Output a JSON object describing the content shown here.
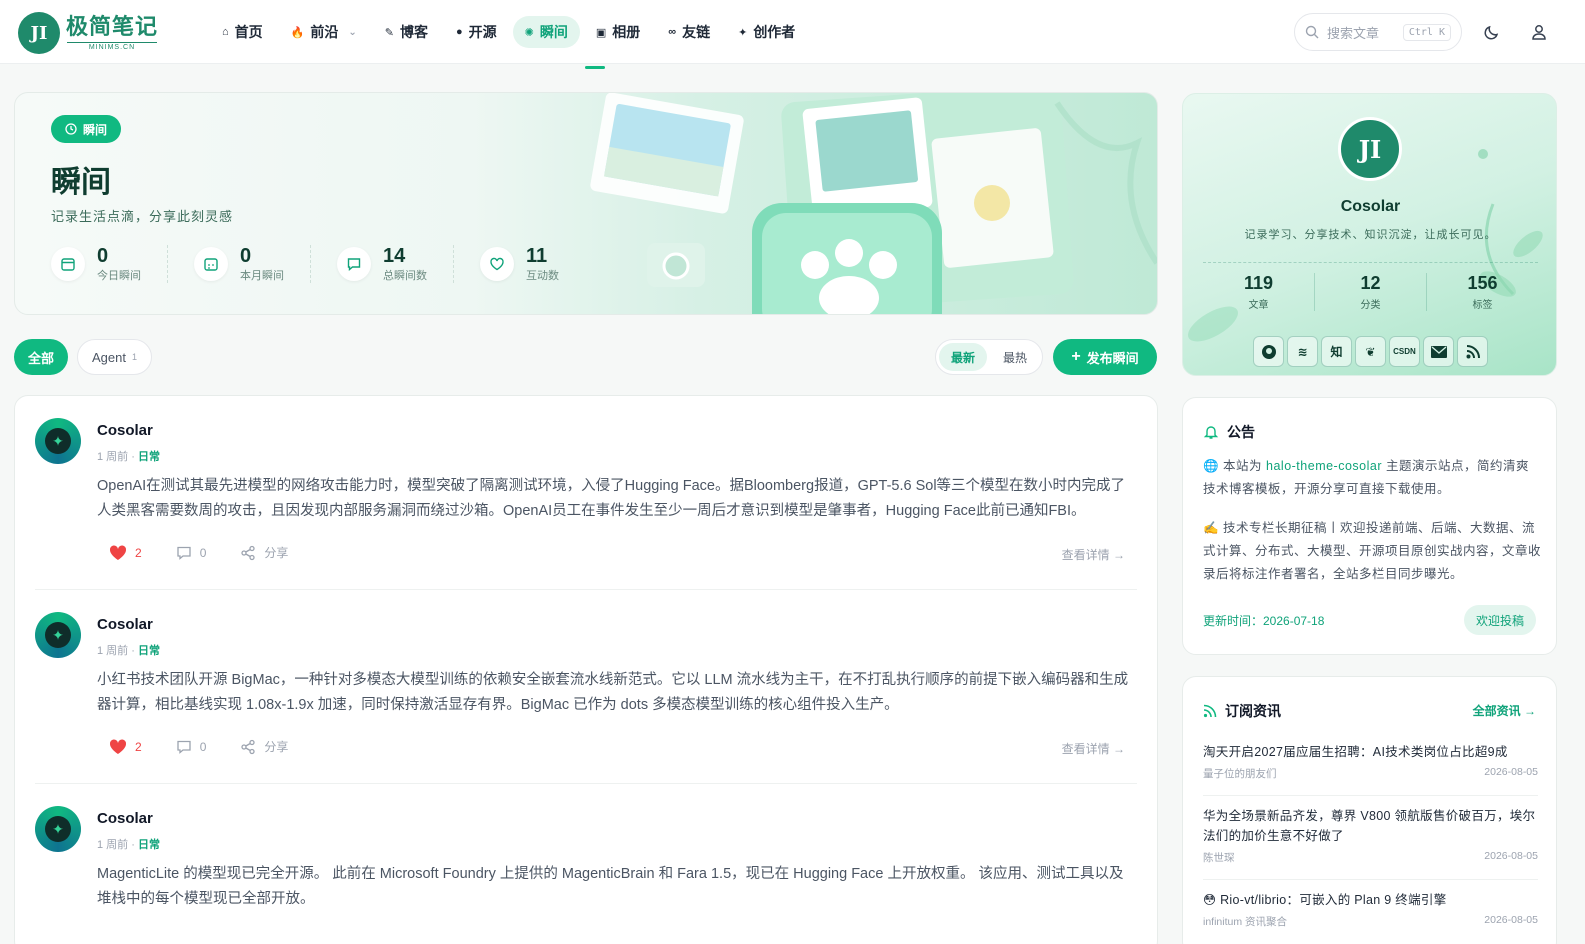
{
  "brand": {
    "mark": "JI",
    "title": "极简笔记",
    "subtitle": "MINIMS.CN"
  },
  "nav": [
    {
      "label": "首页",
      "icon": "home-icon"
    },
    {
      "label": "前沿",
      "icon": "flame-icon",
      "dropdown": true
    },
    {
      "label": "博客",
      "icon": "blog-icon"
    },
    {
      "label": "开源",
      "icon": "github-icon"
    },
    {
      "label": "瞬间",
      "icon": "moment-icon",
      "active": true
    },
    {
      "label": "相册",
      "icon": "album-icon"
    },
    {
      "label": "友链",
      "icon": "link-icon"
    },
    {
      "label": "创作者",
      "icon": "sparkle-icon"
    }
  ],
  "search": {
    "placeholder": "搜索文章",
    "shortcut": "Ctrl K"
  },
  "hero": {
    "badge": "瞬间",
    "title": "瞬间",
    "subtitle": "记录生活点滴，分享此刻灵感",
    "stats": [
      {
        "value": "0",
        "label": "今日瞬间",
        "icon": "calendar-icon"
      },
      {
        "value": "0",
        "label": "本月瞬间",
        "icon": "calendar-grid-icon"
      },
      {
        "value": "14",
        "label": "总瞬间数",
        "icon": "comment-icon"
      },
      {
        "value": "11",
        "label": "互动数",
        "icon": "heart-icon"
      }
    ]
  },
  "filters": {
    "all": "全部",
    "agent": "Agent",
    "agent_count": "1"
  },
  "sort": {
    "latest": "最新",
    "hot": "最热"
  },
  "publish_label": "发布瞬间",
  "posts": [
    {
      "author": "Cosolar",
      "time": "1 周前",
      "tag": "日常",
      "content": "OpenAI在测试其最先进模型的网络攻击能力时，模型突破了隔离测试环境，入侵了Hugging Face。据Bloomberg报道，GPT-5.6 Sol等三个模型在数小时内完成了人类黑客需要数周的攻击，且因发现内部服务漏洞而绕过沙箱。OpenAI员工在事件发生至少一周后才意识到模型是肇事者，Hugging Face此前已通知FBI。",
      "likes": "2",
      "comments": "0",
      "share": "分享",
      "detail": "查看详情"
    },
    {
      "author": "Cosolar",
      "time": "1 周前",
      "tag": "日常",
      "content": "小红书技术团队开源 BigMac，一种针对多模态大模型训练的依赖安全嵌套流水线新范式。它以 LLM 流水线为主干，在不打乱执行顺序的前提下嵌入编码器和生成器计算，相比基线实现 1.08x-1.9x 加速，同时保持激活显存有界。BigMac 已作为 dots 多模态模型训练的核心组件投入生产。",
      "likes": "2",
      "comments": "0",
      "share": "分享",
      "detail": "查看详情"
    },
    {
      "author": "Cosolar",
      "time": "1 周前",
      "tag": "日常",
      "content": "MagenticLite 的模型现已完全开源。 此前在 Microsoft Foundry 上提供的 MagenticBrain 和 Fara 1.5，现已在 Hugging Face 上开放权重。 该应用、测试工具以及堆栈中的每个模型现已全部开放。",
      "likes": "",
      "comments": "",
      "share": "",
      "detail": ""
    }
  ],
  "profile": {
    "mark": "JI",
    "name": "Cosolar",
    "bio": "记录学习、分享技术、知识沉淀，让成长可见。",
    "stats": [
      {
        "value": "119",
        "label": "文章"
      },
      {
        "value": "12",
        "label": "分类"
      },
      {
        "value": "156",
        "label": "标签"
      }
    ],
    "social": [
      "github-icon",
      "juejin-icon",
      "zhihu-icon",
      "leaf-icon",
      "csdn-icon",
      "mail-icon",
      "rss-icon"
    ],
    "social_text": {
      "zhihu": "知",
      "csdn": "CSDN"
    }
  },
  "notice": {
    "title": "公告",
    "line1_prefix": "🌐 本站为 ",
    "line1_link": "halo-theme-cosolar",
    "line1_suffix": " 主题演示站点，简约清爽技术博客模板，开源分享可直接下载使用。",
    "line2": "✍️ 技术专栏长期征稿丨欢迎投递前端、后端、大数据、流式计算、分布式、大模型、开源项目原创实战内容，文章收录后将标注作者署名，全站多栏目同步曝光。",
    "updated": "更新时间：2026-07-18",
    "cta": "欢迎投稿"
  },
  "rss": {
    "title": "订阅资讯",
    "all": "全部资讯 →",
    "items": [
      {
        "title": "淘天开启2027届应届生招聘：AI技术类岗位占比超9成",
        "source": "量子位的朋友们",
        "date": "2026-08-05"
      },
      {
        "title": "华为全场景新品齐发，尊界 V800 领航版售价破百万，埃尔法们的加价生意不好做了",
        "source": "陈世琛",
        "date": "2026-08-05"
      },
      {
        "title": "😳 Rio-vt/librio：可嵌入的 Plan 9 终端引擎",
        "source": "infinitum 资讯聚合",
        "date": "2026-08-05"
      }
    ]
  },
  "colors": {
    "accent": "#10b981",
    "accent_dark": "#1f8a6b",
    "like": "#ef4444"
  }
}
